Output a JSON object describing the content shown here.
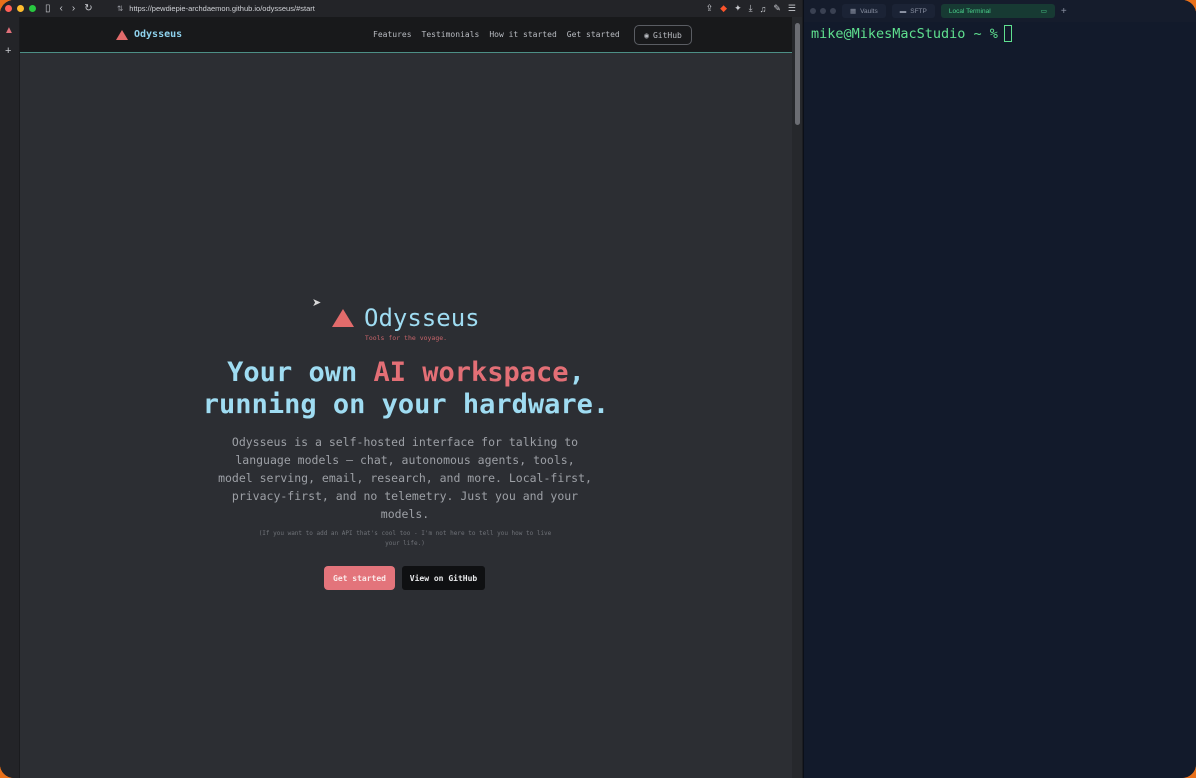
{
  "browser": {
    "url": "https://pewdiepie-archdaemon.github.io/odysseus/#start"
  },
  "site": {
    "brand": "Odysseus",
    "nav": [
      "Features",
      "Testimonials",
      "How it started",
      "Get started"
    ],
    "github_label": "GitHub"
  },
  "hero": {
    "logo_name": "Odysseus",
    "tagline": "Tools for the voyage.",
    "headline_part1": "Your own ",
    "headline_accent": "AI workspace",
    "headline_part2": ",",
    "headline_line2": "running on your hardware.",
    "description": "Odysseus is a self-hosted interface for talking to language models — chat, autonomous agents, tools, model serving, email, research, and more. Local-first, privacy-first, and no telemetry. Just you and your models.",
    "aside": "(If you want to add an API that's cool too - I'm not here to tell you how to live your life.)",
    "cta_primary": "Get started",
    "cta_secondary": "View on GitHub"
  },
  "terminal": {
    "tabs": [
      "Vaults",
      "SFTP",
      "Local Terminal"
    ],
    "prompt": "mike@MikesMacStudio ~ %"
  },
  "colors": {
    "accent": "#e3747b",
    "heading": "#9fdcf2",
    "terminal_green": "#5fe08f"
  }
}
